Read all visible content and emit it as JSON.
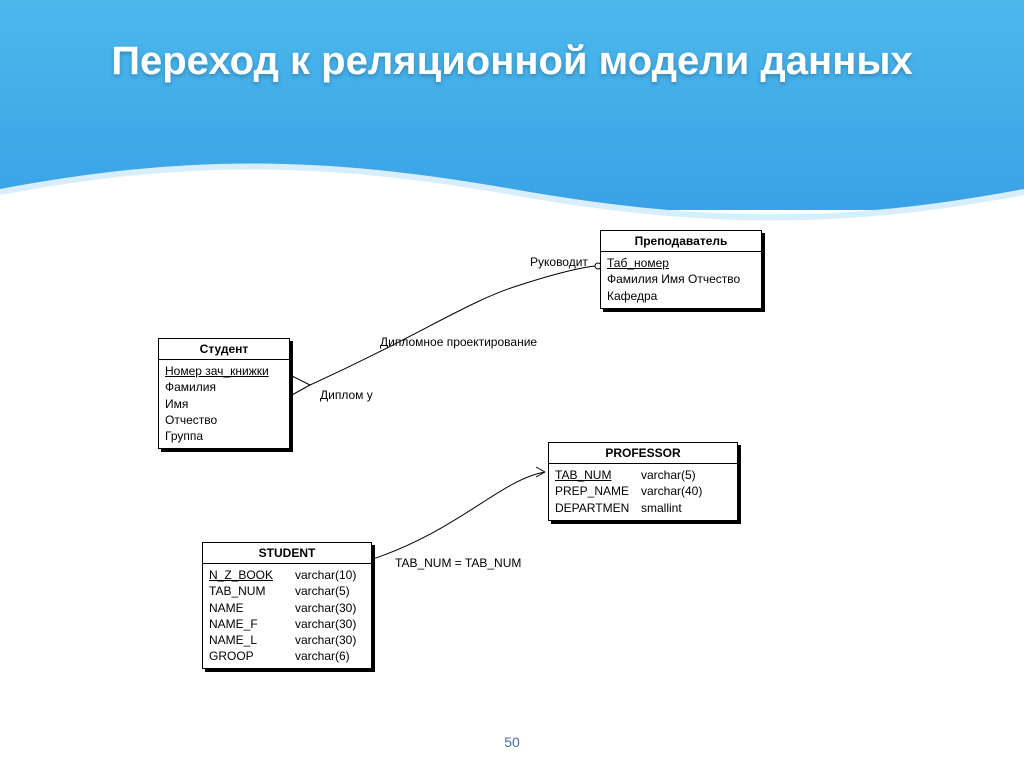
{
  "slide": {
    "title": "Переход к реляционной модели данных",
    "page_number": "50"
  },
  "labels": {
    "supervises": "Руководит",
    "diploma_project": "Дипломное проектирование",
    "diploma_at": "Диплом у",
    "tab_join": "TAB_NUM = TAB_NUM"
  },
  "entities": {
    "teacher": {
      "title": "Преподаватель",
      "fields": [
        {
          "name": "Таб_номер",
          "key": true
        },
        {
          "name": "Фамилия Имя Отчество"
        },
        {
          "name": "Кафедра"
        }
      ]
    },
    "student": {
      "title": "Студент",
      "fields": [
        {
          "name": "Номер зач_книжки",
          "key": true
        },
        {
          "name": "Фамилия"
        },
        {
          "name": "Имя"
        },
        {
          "name": "Отчество"
        },
        {
          "name": "Группа"
        }
      ]
    },
    "professor": {
      "title": "PROFESSOR",
      "fields": [
        {
          "name": "TAB_NUM",
          "type": "varchar(5)",
          "key": true
        },
        {
          "name": "PREP_NAME",
          "type": "varchar(40)"
        },
        {
          "name": "DEPARTMEN",
          "type": "smallint"
        }
      ]
    },
    "student_tbl": {
      "title": "STUDENT",
      "fields": [
        {
          "name": "N_Z_BOOK",
          "type": "varchar(10)",
          "key": true
        },
        {
          "name": "TAB_NUM",
          "type": "varchar(5)"
        },
        {
          "name": "NAME",
          "type": "varchar(30)"
        },
        {
          "name": "NAME_F",
          "type": "varchar(30)"
        },
        {
          "name": "NAME_L",
          "type": "varchar(30)"
        },
        {
          "name": "GROOP",
          "type": "varchar(6)"
        }
      ]
    }
  }
}
